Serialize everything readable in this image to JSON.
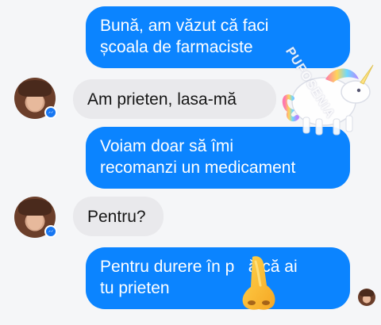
{
  "messages": [
    {
      "direction": "outgoing",
      "lines": [
        "Bună, am văzut că faci",
        "școala de farmaciste"
      ]
    },
    {
      "direction": "incoming",
      "lines": [
        "Am prieten, lasa-mă"
      ]
    },
    {
      "direction": "outgoing",
      "lines": [
        "Voiam doar să îmi",
        "recomanzi un medicament"
      ]
    },
    {
      "direction": "incoming",
      "lines": [
        "Pentru?"
      ]
    },
    {
      "direction": "outgoing",
      "lines": [
        "Pentru durere în p   ă că ai",
        "tu prieten"
      ]
    }
  ],
  "avatars": {
    "contact_icon": "profile-photo",
    "badge_icon": "messenger-icon",
    "read_receipt_icon": "seen-avatar"
  },
  "watermark": {
    "text": "PUFOSENIA",
    "icon": "unicorn-icon"
  },
  "overlay": {
    "icon": "nose-emoji"
  },
  "colors": {
    "outgoing_bubble": "#0b84ff",
    "incoming_bubble": "#e9e9ec",
    "background": "#f5f6f8",
    "messenger_badge": "#1877f2"
  }
}
